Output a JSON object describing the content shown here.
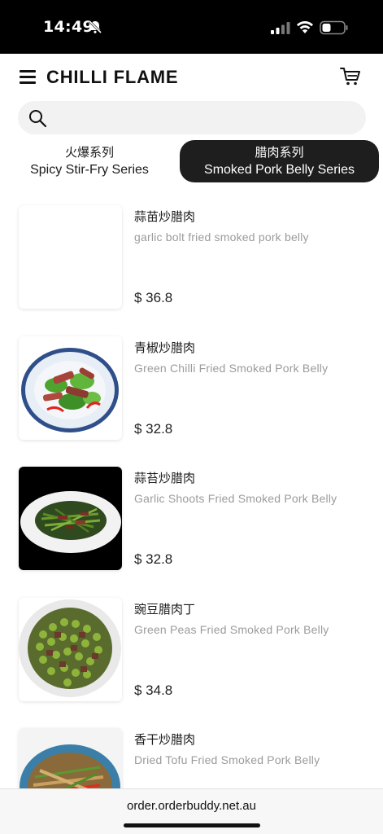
{
  "status_bar": {
    "time": "14:49",
    "icons": [
      "bell-slash-icon",
      "signal-icon",
      "wifi-icon",
      "battery-icon"
    ]
  },
  "header": {
    "brand": "CHILLI FLAME",
    "icons": [
      "menu-icon",
      "cart-icon"
    ]
  },
  "search": {
    "placeholder": "",
    "value": ""
  },
  "tabs": [
    {
      "label_zh": "火爆系列",
      "label_en": "Spicy Stir-Fry Series",
      "selected": false
    },
    {
      "label_zh": "腊肉系列",
      "label_en": "Smoked Pork Belly Series",
      "selected": true
    }
  ],
  "items": [
    {
      "name_zh": "蒜苗炒腊肉",
      "name_en": "garlic bolt fried smoked pork belly",
      "price": "$ 36.8",
      "image": "blank"
    },
    {
      "name_zh": "青椒炒腊肉",
      "name_en": "Green Chilli Fried Smoked Pork Belly",
      "price": "$ 32.8",
      "image": "green-chilli-dish"
    },
    {
      "name_zh": "蒜苔炒腊肉",
      "name_en": "Garlic Shoots Fried Smoked Pork Belly",
      "price": "$ 32.8",
      "image": "garlic-shoots-dish"
    },
    {
      "name_zh": "豌豆腊肉丁",
      "name_en": "Green Peas Fried Smoked Pork Belly",
      "price": "$ 34.8",
      "image": "green-peas-dish"
    },
    {
      "name_zh": "香干炒腊肉",
      "name_en": "Dried Tofu Fried Smoked Pork Belly",
      "price": "",
      "image": "dried-tofu-dish"
    }
  ],
  "browser": {
    "url": "order.orderbuddy.net.au"
  },
  "colors": {
    "status_bar_bg": "#000000",
    "active_tab_bg": "#1e1e1e",
    "search_bg": "#f2f2f2",
    "secondary_text": "#9b9b9b"
  }
}
